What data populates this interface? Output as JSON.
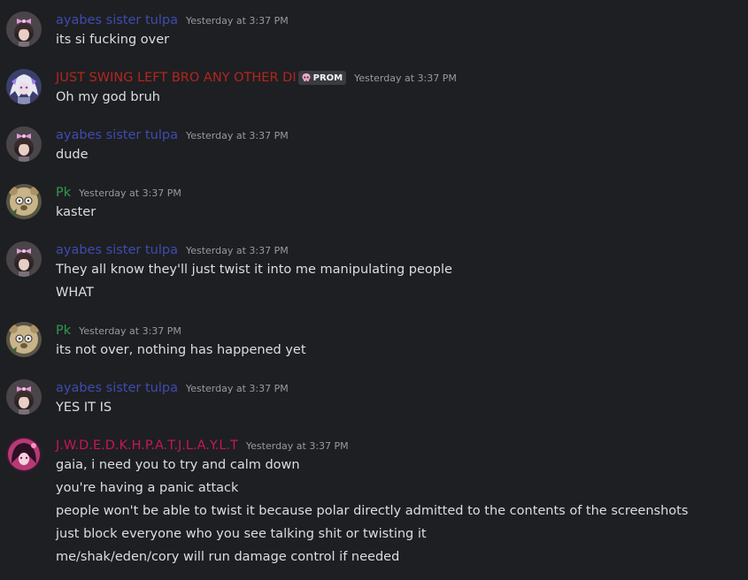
{
  "colors": {
    "background": "#1e1f22",
    "text": "#dbdee1",
    "timestamp": "#949ba4",
    "name_ayabes": "#3f4bb0",
    "name_swing": "#b3261e",
    "name_pk": "#2e9b4f",
    "name_jwd": "#c9145b"
  },
  "messages": [
    {
      "author": "ayabes sister tulpa",
      "timestamp": "Yesterday at 3:37 PM",
      "avatar_icon": "anime-girl-bow-avatar",
      "lines": [
        "its si fucking over"
      ]
    },
    {
      "author": "JUST SWING LEFT BRO ANY OTHER DI",
      "badge": "PROM",
      "badge_icon": "skull-icon",
      "timestamp": "Yesterday at 3:37 PM",
      "avatar_icon": "white-haired-character-avatar",
      "lines": [
        "Oh my god bruh"
      ]
    },
    {
      "author": "ayabes sister tulpa",
      "timestamp": "Yesterday at 3:37 PM",
      "avatar_icon": "anime-girl-bow-avatar",
      "lines": [
        "dude"
      ]
    },
    {
      "author": "Pk",
      "timestamp": "Yesterday at 3:37 PM",
      "avatar_icon": "bear-avatar",
      "lines": [
        "kaster"
      ]
    },
    {
      "author": "ayabes sister tulpa",
      "timestamp": "Yesterday at 3:37 PM",
      "avatar_icon": "anime-girl-bow-avatar",
      "lines": [
        "They all know they'll just twist it into me manipulating people",
        "WHAT"
      ]
    },
    {
      "author": "Pk",
      "timestamp": "Yesterday at 3:37 PM",
      "avatar_icon": "bear-avatar",
      "lines": [
        "its not over, nothing has happened yet"
      ]
    },
    {
      "author": "ayabes sister tulpa",
      "timestamp": "Yesterday at 3:37 PM",
      "avatar_icon": "anime-girl-bow-avatar",
      "lines": [
        "YES IT IS"
      ]
    },
    {
      "author": "J.W.D.E.D.K.H.P.A.T.J.L.A.Y.L.T",
      "timestamp": "Yesterday at 3:37 PM",
      "avatar_icon": "pink-character-avatar",
      "lines": [
        "gaia, i need you to try and calm down",
        "you're having a panic attack",
        "people won't be able to twist it because polar directly admitted to the contents of the screenshots",
        "just block everyone who you see talking shit or twisting it",
        "me/shak/eden/cory will run damage control if needed"
      ]
    }
  ]
}
